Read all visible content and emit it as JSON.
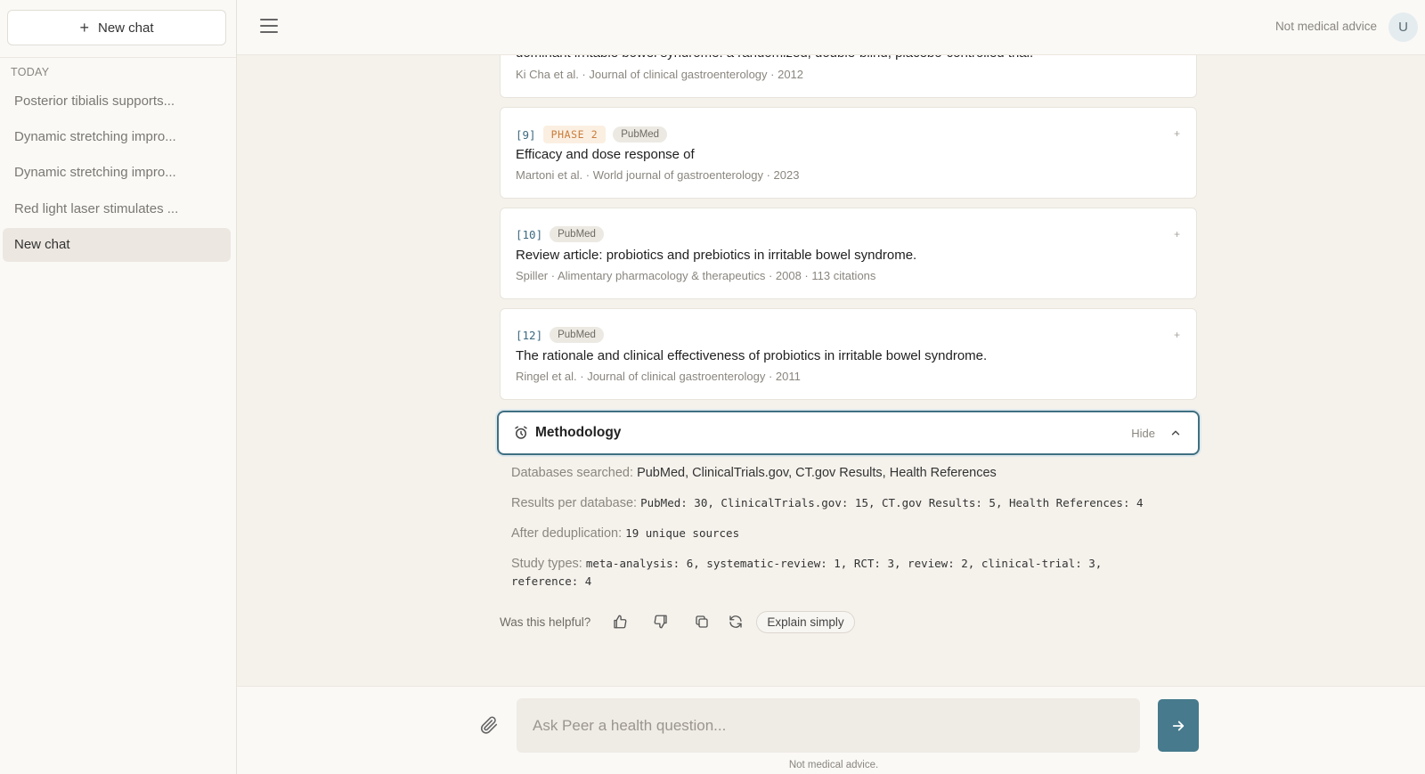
{
  "sidebar": {
    "new_chat_label": "New chat",
    "section_label": "TODAY",
    "items": [
      {
        "label": "Posterior tibialis supports..."
      },
      {
        "label": "Dynamic stretching impro..."
      },
      {
        "label": "Dynamic stretching impro..."
      },
      {
        "label": "Red light laser stimulates ..."
      },
      {
        "label": "New chat"
      }
    ]
  },
  "topbar": {
    "note": "Not medical advice",
    "avatar_initial": "U"
  },
  "cards": [
    {
      "title": "dominant irritable bowel syndrome: a randomized, double-blind, placebo-controlled trial.",
      "meta": "Ki Cha et al. · Journal of clinical gastroenterology · 2012"
    },
    {
      "ref": "[9]",
      "phase": "PHASE 2",
      "source": "PubMed",
      "title": "Efficacy and dose response of",
      "meta": "Martoni et al. · World journal of gastroenterology · 2023",
      "add": "+"
    },
    {
      "ref": "[10]",
      "source": "PubMed",
      "title": "Review article: probiotics and prebiotics in irritable bowel syndrome.",
      "meta": "Spiller · Alimentary pharmacology & therapeutics · 2008 · 113 citations",
      "add": "+"
    },
    {
      "ref": "[12]",
      "source": "PubMed",
      "title": "The rationale and clinical effectiveness of probiotics in irritable bowel syndrome.",
      "meta": "Ringel et al. · Journal of clinical gastroenterology · 2011",
      "add": "+"
    }
  ],
  "methodology": {
    "title": "Methodology",
    "hide_label": "Hide",
    "databases_label": "Databases searched:",
    "databases_value": "PubMed, ClinicalTrials.gov, CT.gov Results, Health References",
    "results_label": "Results per database:",
    "results_value": "PubMed: 30, ClinicalTrials.gov: 15, CT.gov Results: 5, Health References: 4",
    "dedup_label": "After deduplication:",
    "dedup_value": "19 unique sources",
    "types_label": "Study types:",
    "types_value": "meta-analysis: 6, systematic-review: 1, RCT: 3, review: 2, clinical-trial: 3, reference: 4"
  },
  "feedback": {
    "question": "Was this helpful?",
    "explain_label": "Explain simply"
  },
  "composer": {
    "placeholder": "Ask Peer a health question...",
    "disclaimer": "Not medical advice."
  },
  "icons": {
    "menu": "hamburger-menu-icon",
    "methodology": "alarm-clock-icon",
    "chevron": "chevron-up-icon",
    "thumbs_up": "thumbs-up-icon",
    "thumbs_down": "thumbs-down-icon",
    "copy": "copy-icon",
    "refresh": "refresh-icon",
    "attach": "paperclip-icon",
    "send": "arrow-right-icon"
  },
  "colors": {
    "accent": "#467a8c",
    "phase_badge": "#c97d3a",
    "ref_number": "#3d6a80"
  }
}
